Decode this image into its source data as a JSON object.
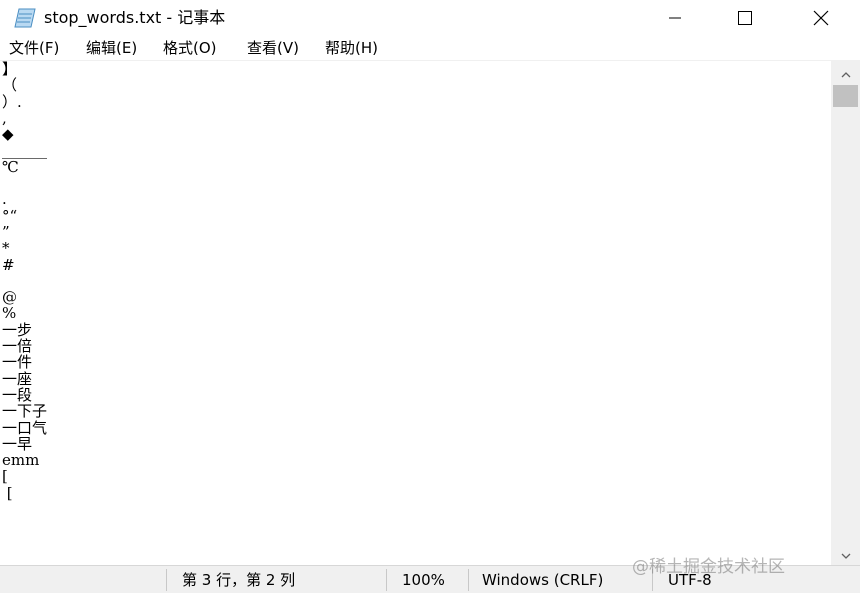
{
  "window": {
    "title": "stop_words.txt - 记事本"
  },
  "menu": {
    "file": "文件(F)",
    "edit": "编辑(E)",
    "format": "格式(O)",
    "view": "查看(V)",
    "help": "帮助(H)"
  },
  "editor": {
    "lines": [
      "】",
      "（",
      "）.",
      ",",
      "◆",
      "______",
      "℃",
      "",
      ".",
      "°“",
      "”",
      "*",
      "#",
      "",
      "@",
      "%",
      "一步",
      "一倍",
      "一件",
      "一座",
      "一段",
      "一下子",
      "一口气",
      "一早",
      "emm",
      "[",
      " ["
    ]
  },
  "status": {
    "position": "第 3 行，第 2 列",
    "zoom": "100%",
    "line_ending": "Windows (CRLF)",
    "encoding": "UTF-8"
  },
  "watermark": "@稀土掘金技术社区",
  "icons": {
    "app": "notepad-icon",
    "minimize": "minimize-icon",
    "maximize": "maximize-icon",
    "close": "close-icon",
    "scroll_up": "arrow-up-icon",
    "scroll_down": "arrow-down-icon"
  }
}
